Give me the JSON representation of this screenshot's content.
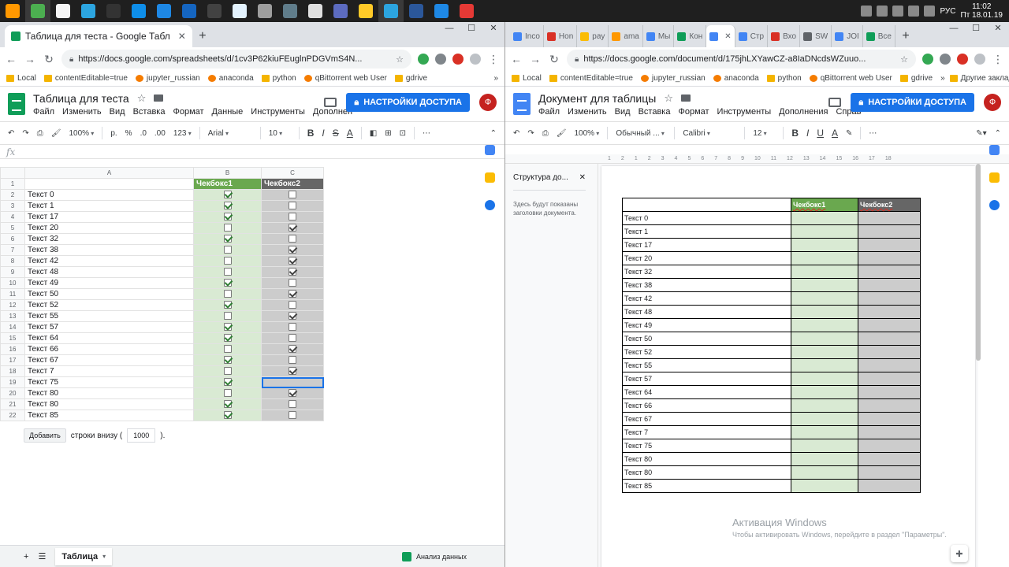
{
  "taskbar": {
    "icons": [
      {
        "name": "sublime-icon",
        "color": "#ff9800"
      },
      {
        "name": "chrome-icon",
        "color": "#4caf50"
      },
      {
        "name": "notepad-icon",
        "color": "#f5f5f5"
      },
      {
        "name": "telegram-icon",
        "color": "#2ca5e0"
      },
      {
        "name": "terminal-icon",
        "color": "#333333"
      },
      {
        "name": "teamviewer-icon",
        "color": "#0e8ee9"
      },
      {
        "name": "app-icon",
        "color": "#1e88e5"
      },
      {
        "name": "powershell-icon",
        "color": "#1565c0"
      },
      {
        "name": "console-icon",
        "color": "#424242"
      },
      {
        "name": "file-icon",
        "color": "#e3f2fd"
      },
      {
        "name": "monitor-icon",
        "color": "#9e9e9e"
      },
      {
        "name": "network-icon",
        "color": "#607d8b"
      },
      {
        "name": "clock-app-icon",
        "color": "#e0e0e0"
      },
      {
        "name": "disc-icon",
        "color": "#5c6bc0"
      },
      {
        "name": "folder-icon",
        "color": "#ffca28"
      },
      {
        "name": "telegram2-icon",
        "color": "#2ca5e0"
      },
      {
        "name": "word-icon",
        "color": "#2b579a"
      },
      {
        "name": "screen-icon",
        "color": "#1e88e5"
      },
      {
        "name": "anydesk-icon",
        "color": "#e53935"
      }
    ],
    "lang": "РУС",
    "time": "11:02",
    "date": "Пт 18.01.19"
  },
  "left": {
    "tab_title": "Таблица для теста - Google Табл",
    "url": "https://docs.google.com/spreadsheets/d/1cv3P62kiuFEuglnPDGVmS4N...",
    "bookmarks": [
      "Local",
      "contentEditable=true",
      "jupyter_russian",
      "anaconda",
      "python",
      "qBittorrent web User",
      "gdrive"
    ],
    "bookmarks_more": "»",
    "doc_title": "Таблица для теста",
    "menu": [
      "Файл",
      "Изменить",
      "Вид",
      "Вставка",
      "Формат",
      "Данные",
      "Инструменты",
      "Дополнен"
    ],
    "share_label": "НАСТРОЙКИ ДОСТУПА",
    "avatar_letter": "Ф",
    "toolbar": {
      "zoom": "100%",
      "currency": "р.",
      "percent": "%",
      "dec_less": ".0",
      "dec_more": ".00",
      "format": "123",
      "font": "Arial",
      "size": "10",
      "bold": "B",
      "italic": "I",
      "strike": "S",
      "textcolor": "A",
      "more": "⋯"
    },
    "fx": "fx",
    "col_headers": [
      "A",
      "B",
      "C"
    ],
    "header_row": {
      "num": "1",
      "a": "",
      "b": "Чекбокс1",
      "c": "Чекбокс2"
    },
    "rows": [
      {
        "num": "2",
        "text": "Текст 0",
        "b": true,
        "c": false
      },
      {
        "num": "3",
        "text": "Текст 1",
        "b": true,
        "c": false
      },
      {
        "num": "4",
        "text": "Текст 17",
        "b": true,
        "c": false
      },
      {
        "num": "5",
        "text": "Текст 20",
        "b": false,
        "c": true
      },
      {
        "num": "6",
        "text": "Текст 32",
        "b": true,
        "c": false
      },
      {
        "num": "7",
        "text": "Текст 38",
        "b": false,
        "c": true
      },
      {
        "num": "8",
        "text": "Текст 42",
        "b": false,
        "c": true
      },
      {
        "num": "9",
        "text": "Текст 48",
        "b": false,
        "c": true
      },
      {
        "num": "10",
        "text": "Текст 49",
        "b": true,
        "c": false
      },
      {
        "num": "11",
        "text": "Текст 50",
        "b": false,
        "c": true
      },
      {
        "num": "12",
        "text": "Текст 52",
        "b": true,
        "c": false
      },
      {
        "num": "13",
        "text": "Текст 55",
        "b": false,
        "c": true
      },
      {
        "num": "14",
        "text": "Текст 57",
        "b": true,
        "c": false
      },
      {
        "num": "15",
        "text": "Текст 64",
        "b": true,
        "c": false
      },
      {
        "num": "16",
        "text": "Текст 66",
        "b": false,
        "c": true
      },
      {
        "num": "17",
        "text": "Текст 67",
        "b": true,
        "c": false
      },
      {
        "num": "18",
        "text": "Текст 7",
        "b": false,
        "c": true
      },
      {
        "num": "19",
        "text": "Текст 75",
        "b": true,
        "c": null
      },
      {
        "num": "20",
        "text": "Текст 80",
        "b": false,
        "c": true
      },
      {
        "num": "21",
        "text": "Текст 80",
        "b": true,
        "c": false
      },
      {
        "num": "22",
        "text": "Текст 85",
        "b": true,
        "c": false
      }
    ],
    "add_button": "Добавить",
    "add_text_before": "строки внизу (",
    "add_count": "1000",
    "add_text_after": ").",
    "sheet_tab": "Таблица",
    "explore_label": "Анализ данных"
  },
  "right": {
    "tabs": [
      "Inco",
      "Hon",
      "pay",
      "ama",
      "Мы",
      "Кон",
      "",
      "Стр",
      "Вхо",
      "SW",
      "JOI",
      "Все"
    ],
    "url": "https://docs.google.com/document/d/175jhLXYawCZ-a8IaDNcdsWZuuo...",
    "bookmarks": [
      "Local",
      "contentEditable=true",
      "jupyter_russian",
      "anaconda",
      "python",
      "qBittorrent web User",
      "gdrive"
    ],
    "bookmarks_more": "»",
    "other_bookmarks": "Другие закладки",
    "doc_title": "Документ для таблицы",
    "menu": [
      "Файл",
      "Изменить",
      "Вид",
      "Вставка",
      "Формат",
      "Инструменты",
      "Дополнения",
      "Справ"
    ],
    "share_label": "НАСТРОЙКИ ДОСТУПА",
    "avatar_letter": "Ф",
    "toolbar": {
      "zoom": "100%",
      "style": "Обычный ...",
      "font": "Calibri",
      "size": "12",
      "bold": "B",
      "italic": "I",
      "underline": "U",
      "textcolor": "A",
      "more": "⋯"
    },
    "outline_title": "Структура до...",
    "outline_body": "Здесь будут показаны заголовки документа.",
    "ruler": [
      "1",
      "2",
      "1",
      "2",
      "3",
      "4",
      "5",
      "6",
      "7",
      "8",
      "9",
      "10",
      "11",
      "12",
      "13",
      "14",
      "15",
      "16",
      "17",
      "18"
    ],
    "table_header": {
      "a": "",
      "b": "Чекбокс1",
      "c": "Чекбокс2"
    },
    "rows": [
      "Текст 0",
      "Текст 1",
      "Текст 17",
      "Текст 20",
      "Текст 32",
      "Текст 38",
      "Текст 42",
      "Текст 48",
      "Текст 49",
      "Текст 50",
      "Текст 52",
      "Текст 55",
      "Текст 57",
      "Текст 64",
      "Текст 66",
      "Текст 67",
      "Текст 7",
      "Текст 75",
      "Текст 80",
      "Текст 80",
      "Текст 85"
    ],
    "watermark_title": "Активация Windows",
    "watermark_text": "Чтобы активировать Windows, перейдите в раздел \"Параметры\"."
  },
  "colors": {
    "sheets_green": "#0f9d58",
    "docs_blue": "#4285f4",
    "share_blue": "#1a73e8",
    "checkbox1_header": "#6aa84f",
    "checkbox1_cell": "#d9ead3",
    "checkbox2_header": "#666666",
    "checkbox2_cell": "#cccccc",
    "avatar": "#c5221f"
  }
}
